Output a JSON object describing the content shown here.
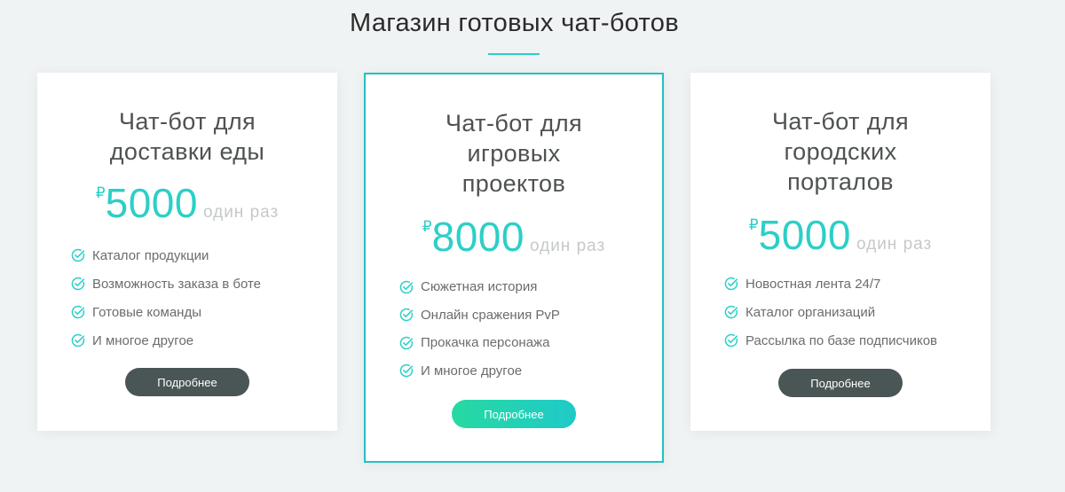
{
  "section": {
    "title": "Магазин готовых чат-ботов"
  },
  "colors": {
    "accent": "#2ccfc7",
    "button_dark": "#4a5555",
    "button_gradient_start": "#27d9a1",
    "button_gradient_end": "#1fcac8",
    "background": "#eff3f3"
  },
  "cards": [
    {
      "title_lines": [
        "Чат-бот для",
        "доставки еды"
      ],
      "currency": "₽",
      "price": "5000",
      "period": "один раз",
      "features": [
        "Каталог продукции",
        "Возможность заказа в боте",
        "Готовые команды",
        "И многое другое"
      ],
      "button_label": "Подробнее",
      "icon": "check-circle-icon"
    },
    {
      "title_lines": [
        "Чат-бот для",
        "игровых",
        "проектов"
      ],
      "currency": "₽",
      "price": "8000",
      "period": "один раз",
      "features": [
        "Сюжетная история",
        "Онлайн сражения PvP",
        "Прокачка персонажа",
        "И многое другое"
      ],
      "button_label": "Подробнее",
      "icon": "check-circle-icon",
      "highlighted": true
    },
    {
      "title_lines": [
        "Чат-бот для",
        "городских",
        "порталов"
      ],
      "currency": "₽",
      "price": "5000",
      "period": "один раз",
      "features": [
        "Новостная лента 24/7",
        "Каталог организаций",
        "Рассылка по базе подписчиков"
      ],
      "button_label": "Подробнее",
      "icon": "check-circle-icon"
    }
  ]
}
